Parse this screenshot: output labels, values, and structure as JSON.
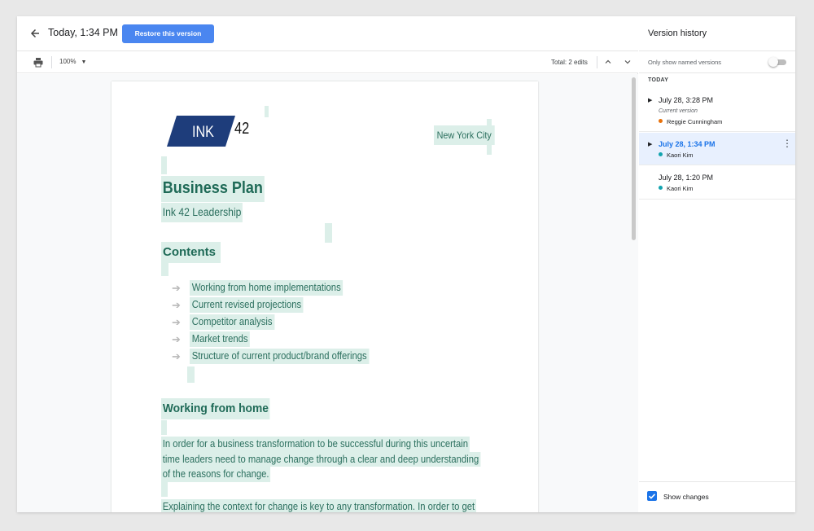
{
  "header": {
    "time": "Today, 1:34 PM",
    "restore_label": "Restore this version"
  },
  "toolbar": {
    "zoom": "100%",
    "total_edits": "Total: 2 edits"
  },
  "document": {
    "logo_text": "INK",
    "logo_number": "42",
    "city": "New York City",
    "title": "Business Plan",
    "subtitle": "Ink 42 Leadership",
    "contents_heading": "Contents",
    "toc": [
      "Working from home implementations",
      "Current revised projections",
      "Competitor analysis",
      "Market trends",
      "Structure of current product/brand offerings"
    ],
    "section_heading": "Working from home",
    "para1": [
      "In order for a business transformation to be successful during this uncertain",
      "time leaders need to manage change through a clear and deep understanding",
      "of the reasons for change."
    ],
    "para2": [
      "Explaining the context for change is key to any transformation. In order to get"
    ]
  },
  "sidebar": {
    "title": "Version history",
    "named_only_label": "Only show named versions",
    "named_only_on": false,
    "group_label": "TODAY",
    "versions": [
      {
        "date": "July 28, 3:28 PM",
        "current_label": "Current version",
        "user": "Reggie Cunningham",
        "user_color": "#e8710a"
      },
      {
        "date": "July 28, 1:34 PM",
        "user": "Kaori Kim",
        "user_color": "#12a4af"
      },
      {
        "date": "July 28, 1:20 PM",
        "user": "Kaori Kim",
        "user_color": "#12a4af"
      }
    ],
    "show_changes_label": "Show changes",
    "show_changes_checked": true
  },
  "colors": {
    "accent": "#1a73e8",
    "restore_button": "#4a86f0",
    "highlight": "#dcefe9",
    "doc_text": "#2b6f5e",
    "logo_fill": "#1e3d7b"
  },
  "icons": {
    "back": "arrow-left-icon",
    "print": "printer-icon",
    "prev": "chevron-up-icon",
    "next": "chevron-down-icon",
    "more": "more-vert-icon",
    "expand": "triangle-right-icon"
  }
}
